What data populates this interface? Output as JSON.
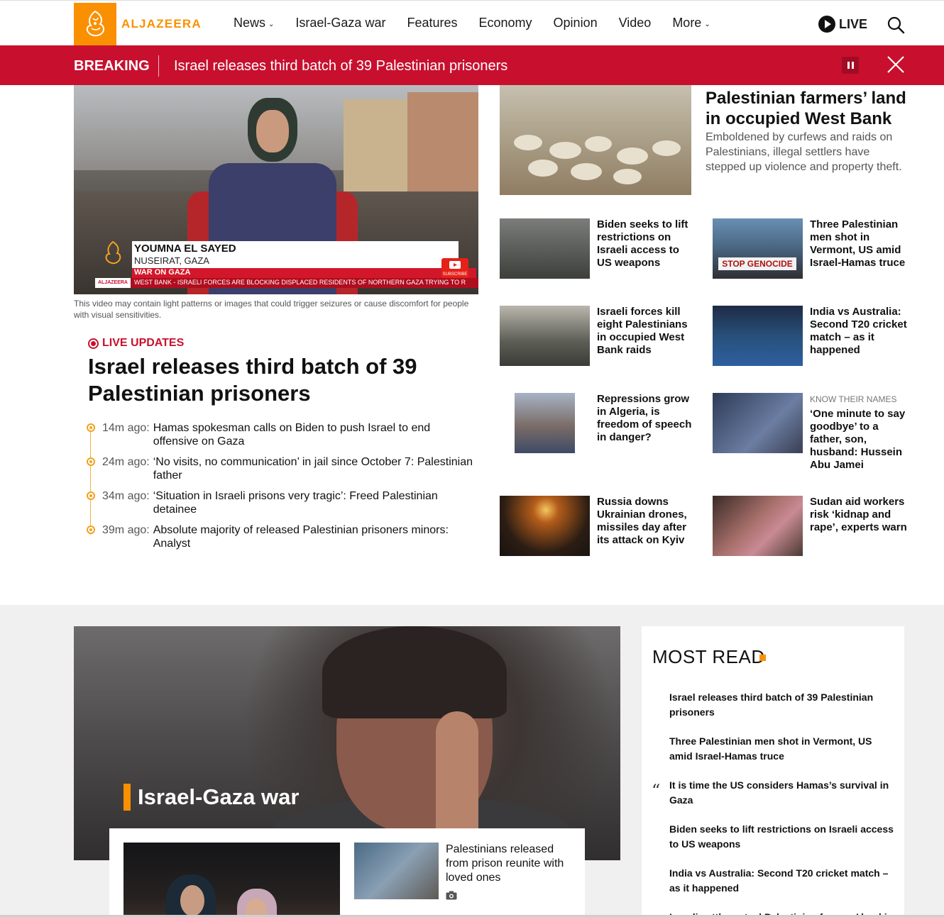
{
  "header": {
    "logo_text": "ALJAZEERA",
    "nav": [
      {
        "label": "News",
        "has_dropdown": true
      },
      {
        "label": "Israel-Gaza war",
        "has_dropdown": false
      },
      {
        "label": "Features",
        "has_dropdown": false
      },
      {
        "label": "Economy",
        "has_dropdown": false
      },
      {
        "label": "Opinion",
        "has_dropdown": false
      },
      {
        "label": "Video",
        "has_dropdown": false
      },
      {
        "label": "More",
        "has_dropdown": true
      }
    ],
    "live_label": "LIVE",
    "icons": {
      "search": "search-icon",
      "play": "play-icon",
      "chevron": "chevron-down-icon"
    }
  },
  "breaking": {
    "tag": "BREAKING",
    "headline": "Israel releases third batch of 39 Palestinian prisoners",
    "icons": {
      "pause": "pause-icon",
      "close": "close-icon"
    }
  },
  "video": {
    "reporter_name": "YOUMNA EL SAYED",
    "reporter_location": "NUSEIRAT, GAZA",
    "strap": "WAR ON GAZA",
    "ticker_brand": "ALJAZEERA",
    "ticker": "WEST BANK  -  ISRAELI FORCES ARE BLOCKING DISPLACED RESIDENTS OF NORTHERN GAZA TRYING TO R",
    "subscribe": "SUBSCRIBE",
    "note": "This video may contain light patterns or images that could trigger seizures or cause discomfort for people with visual sensitivities."
  },
  "live": {
    "label": "LIVE UPDATES",
    "headline": "Israel releases third batch of 39 Palestinian prisoners",
    "updates": [
      {
        "time": "14m ago:",
        "title": "Hamas spokesman calls on Biden to push Israel to end offensive on Gaza"
      },
      {
        "time": "24m ago:",
        "title": "‘No visits, no communication’ in jail since October 7: Palestinian father"
      },
      {
        "time": "34m ago:",
        "title": "‘Situation in Israeli prisons very tragic’: Freed Palestinian detainee"
      },
      {
        "time": "39m ago:",
        "title": "Absolute majority of released Palestinian prisoners minors: Analyst"
      }
    ]
  },
  "feature": {
    "title": "Palestinian farmers’ land in occupied West Bank",
    "summary": "Emboldened by curfews and raids on Palestinians, illegal settlers have stepped up violence and property theft."
  },
  "cards": [
    {
      "kicker": "",
      "title": "Biden seeks to lift restrictions on Israeli access to US weapons"
    },
    {
      "kicker": "",
      "title": "Three Palestinian men shot in Vermont, US amid Israel-Hamas truce"
    },
    {
      "kicker": "",
      "title": "Israeli forces kill eight Palestinians in occupied West Bank raids"
    },
    {
      "kicker": "",
      "title": "India vs Australia: Second T20 cricket match – as it happened"
    },
    {
      "kicker": "",
      "title": "Repressions grow in Algeria, is freedom of speech in danger?"
    },
    {
      "kicker": "KNOW THEIR NAMES",
      "title": "‘One minute to say goodbye’ to a father, son, husband: Hussein Abu Jamei"
    },
    {
      "kicker": "",
      "title": "Russia downs Ukrainian drones, missiles day after its attack on Kyiv"
    },
    {
      "kicker": "",
      "title": "Sudan aid workers risk ‘kidnap and rape’, experts warn"
    }
  ],
  "card_images": {
    "stop_genocide_sign": "STOP GENOCIDE"
  },
  "hero": {
    "section_title": "Israel-Gaza war",
    "story": "Palestinians released from prison reunite with loved ones",
    "icons": {
      "camera": "camera-icon"
    }
  },
  "most_read": {
    "title": "MOST READ",
    "items": [
      "Israel releases third batch of 39 Palestinian prisoners",
      "Three Palestinian men shot in Vermont, US amid Israel-Hamas truce",
      "It is time the US considers Hamas’s survival in Gaza",
      "Biden seeks to lift restrictions on Israeli access to US weapons",
      "India vs Australia: Second T20 cricket match – as it happened",
      "Israeli settlers steal Palestinian farmers’ land in"
    ],
    "quote_mark": "“"
  },
  "colors": {
    "brand_orange": "#fa9000",
    "breaking_red": "#c8102e",
    "live_red": "#c8102e",
    "timeline_orange": "#f2a21e",
    "section_grey": "#f0f0f0"
  }
}
